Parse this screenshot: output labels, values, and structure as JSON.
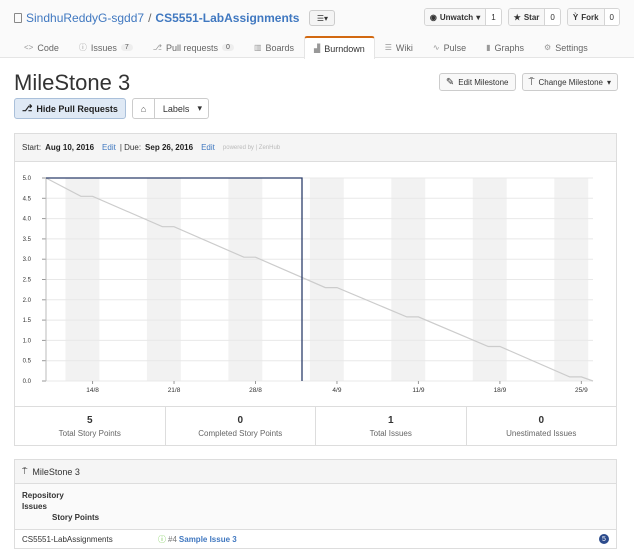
{
  "repo": {
    "owner": "SindhuReddyG-sgdd7",
    "name": "CS5551-LabAssignments",
    "separator": "/"
  },
  "header_buttons": [
    {
      "label": "Unwatch",
      "count": "1",
      "icon": "eye-icon"
    },
    {
      "label": "Star",
      "count": "0",
      "icon": "star-icon"
    },
    {
      "label": "Fork",
      "count": "0",
      "icon": "fork-icon"
    }
  ],
  "tabs": [
    {
      "label": "Code",
      "icon": "<>",
      "badge": ""
    },
    {
      "label": "Issues",
      "icon": "ⓘ",
      "badge": "7"
    },
    {
      "label": "Pull requests",
      "icon": "⎇",
      "badge": "0"
    },
    {
      "label": "Boards",
      "icon": "▥",
      "badge": ""
    },
    {
      "label": "Burndown",
      "icon": "▟",
      "badge": "",
      "active": true
    },
    {
      "label": "Wiki",
      "icon": "☰",
      "badge": ""
    },
    {
      "label": "Pulse",
      "icon": "∿",
      "badge": ""
    },
    {
      "label": "Graphs",
      "icon": "▮",
      "badge": ""
    },
    {
      "label": "Settings",
      "icon": "⚙",
      "badge": ""
    }
  ],
  "milestone": {
    "title": "MileStone 3",
    "edit_label": "Edit Milestone",
    "change_label": "Change Milestone",
    "hide_pr_label": "Hide Pull Requests",
    "labels_label": "Labels"
  },
  "burndown": {
    "start_label": "Start:",
    "start_date": "Aug 10, 2016",
    "edit": "Edit",
    "due_label": "| Due:",
    "due_date": "Sep 26, 2016",
    "powered": "powered by | ZenHub"
  },
  "chart_data": {
    "type": "line",
    "y_ticks": [
      "0.0",
      "0.5",
      "1.0",
      "1.5",
      "2.0",
      "2.5",
      "3.0",
      "3.5",
      "4.0",
      "4.5",
      "5.0"
    ],
    "x_ticks": [
      "14/8",
      "21/8",
      "28/8",
      "4/9",
      "11/9",
      "18/9",
      "25/9"
    ],
    "ylim": [
      0,
      5
    ],
    "series": [
      {
        "values": [
          [
            0,
            5.0
          ],
          [
            3,
            4.55
          ],
          [
            4,
            4.55
          ],
          [
            10,
            3.8
          ],
          [
            11,
            3.8
          ],
          [
            17,
            3.05
          ],
          [
            18,
            3.05
          ],
          [
            24,
            2.3
          ],
          [
            25,
            2.3
          ],
          [
            31,
            1.58
          ],
          [
            32,
            1.58
          ],
          [
            38,
            0.85
          ],
          [
            39,
            0.85
          ],
          [
            45,
            0.1
          ],
          [
            46,
            0.1
          ],
          [
            47,
            0.0
          ]
        ],
        "color": "#cccccc"
      },
      {
        "values": [
          [
            0,
            5.0
          ],
          [
            22,
            5.0
          ],
          [
            22,
            0.0
          ]
        ],
        "color": "#2c3e6b"
      }
    ],
    "weekend_bands_days": [
      3,
      10,
      17,
      24,
      31,
      38,
      45
    ],
    "x_tick_days": [
      4,
      11,
      18,
      25,
      32,
      39,
      46
    ]
  },
  "stats": [
    {
      "value": "5",
      "label": "Total Story Points"
    },
    {
      "value": "0",
      "label": "Completed Story Points"
    },
    {
      "value": "1",
      "label": "Total Issues"
    },
    {
      "value": "0",
      "label": "Unestimated Issues"
    }
  ],
  "issues_panel": {
    "title": "MileStone 3",
    "headers": [
      "Repository",
      "Issues",
      "Story Points"
    ],
    "rows": [
      {
        "repo": "CS5551-LabAssignments",
        "number": "#4",
        "title": "Sample Issue 3",
        "points": "5"
      }
    ]
  }
}
